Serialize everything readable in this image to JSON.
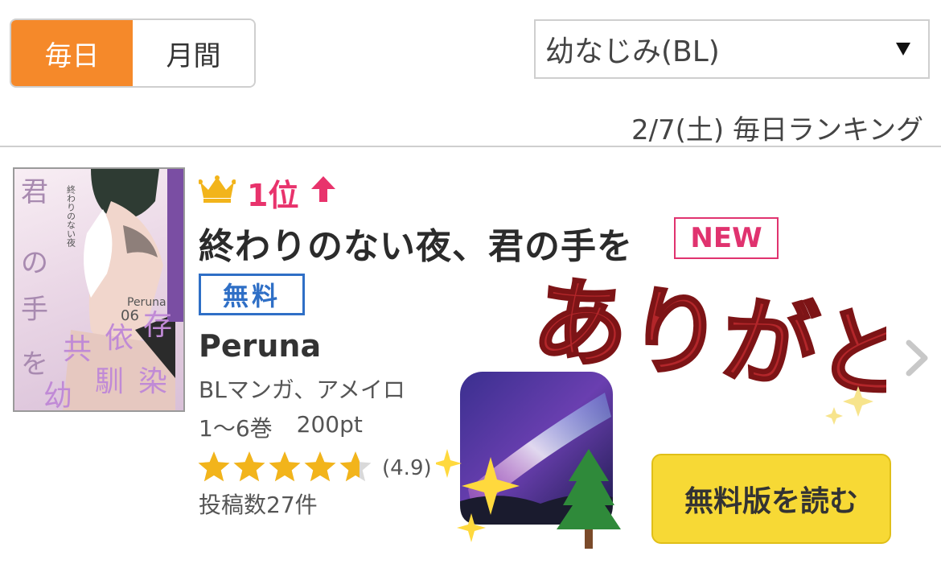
{
  "period_tabs": [
    {
      "label": "毎日",
      "active": true
    },
    {
      "label": "月間",
      "active": false
    }
  ],
  "genre_select": {
    "value": "幼なじみ(BL)"
  },
  "ranking_date": "2/7(土) 毎日ランキング",
  "item": {
    "rank": "1位",
    "rank_trend": "up",
    "title": "終わりのない夜、君の手を",
    "new_badge": "NEW",
    "price_badge": "無料",
    "author": "Peruna",
    "genres": "BLマンガ、アメイロ",
    "volumes": "1〜6巻",
    "price": "200pt",
    "rating": 4.9,
    "rating_text": "(4.9)",
    "posts": "投稿数27件",
    "cover_texts": [
      "君",
      "の",
      "手",
      "を",
      "終わりのない夜",
      "Peruna",
      "06",
      "共",
      "依",
      "存",
      "幼",
      "馴",
      "染"
    ],
    "read_button": "無料版を読む"
  },
  "overlay": {
    "text": "ありがとう"
  },
  "colors": {
    "accent_orange": "#f5892a",
    "rank_pink": "#e8336c",
    "free_blue": "#2f6fc6",
    "button_yellow": "#f7d935",
    "overlay_red": "#b3262a"
  },
  "icons": [
    "crown-icon",
    "up-arrow-icon",
    "star-icon",
    "caret-down-icon",
    "chevron-right-icon",
    "sparkles-icon",
    "milky-way-icon"
  ]
}
